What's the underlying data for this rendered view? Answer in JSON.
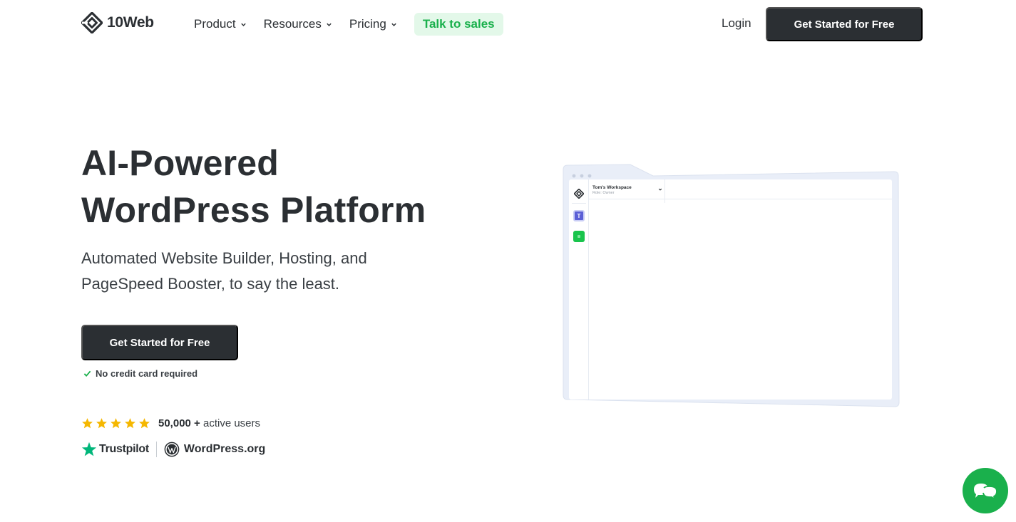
{
  "header": {
    "logo_text": "10Web",
    "nav": [
      {
        "label": "Product"
      },
      {
        "label": "Resources"
      },
      {
        "label": "Pricing"
      }
    ],
    "talk_to_sales": "Talk to sales",
    "login": "Login",
    "cta": "Get Started for Free"
  },
  "hero": {
    "title_line1": "AI-Powered",
    "title_line2": "WordPress Platform",
    "subtitle": "Automated Website Builder, Hosting, and PageSpeed Booster, to say the least.",
    "cta": "Get Started for Free",
    "no_cc": "No credit card required",
    "stars": 5,
    "users_count": "50,000 +",
    "users_label": "active users",
    "trustpilot": "Trustpilot",
    "wordpress_org": "WordPress.org"
  },
  "mockup": {
    "workspace_name": "Tom's Workspace",
    "workspace_role": "Role: Owner",
    "workspace_initial": "T"
  },
  "colors": {
    "dark": "#2b2f33",
    "green": "#1ab04c",
    "green_light": "#e3f8e9",
    "star": "#f5b700",
    "trustpilot": "#00b67a",
    "frame": "#e9eef8"
  }
}
